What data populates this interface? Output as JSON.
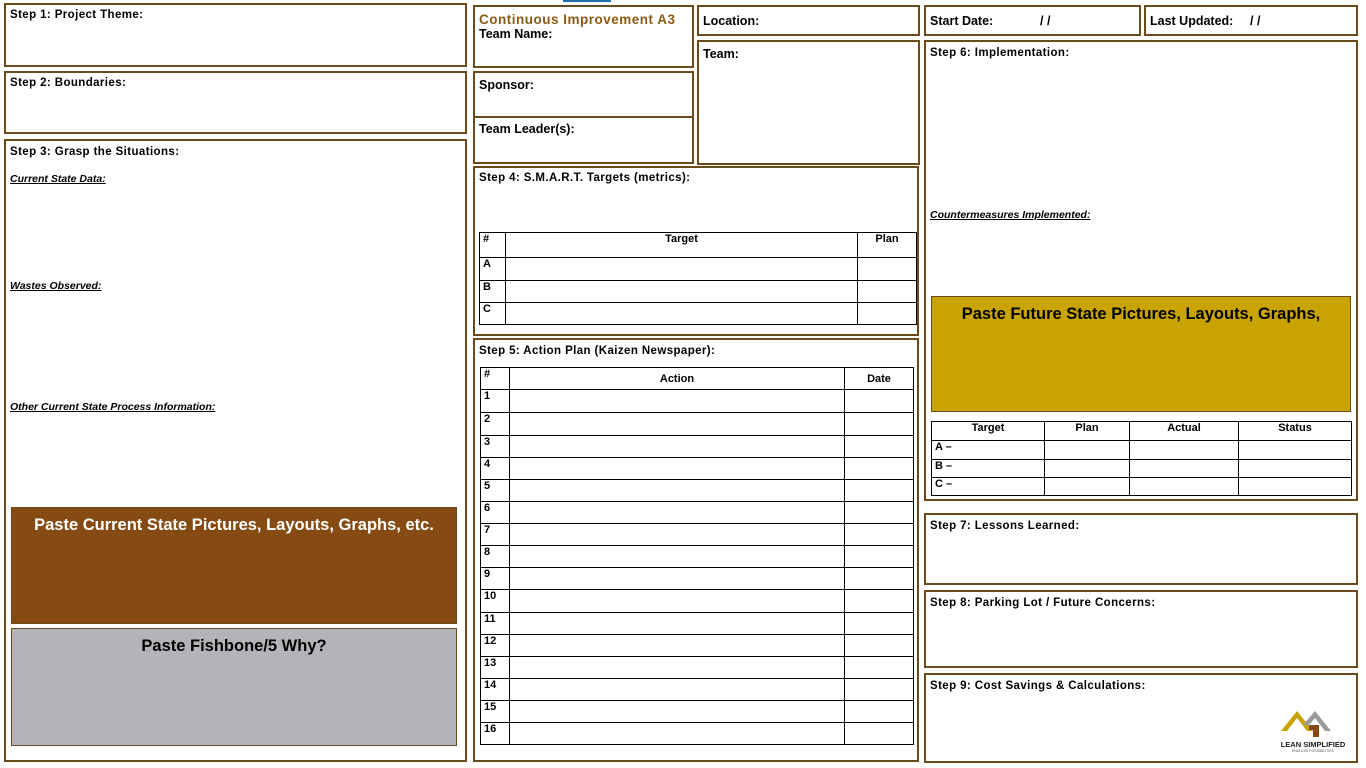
{
  "colors": {
    "border": "#6b4a1c",
    "brown_fill": "#854b12",
    "gold_fill": "#c9a400",
    "gray_fill": "#b3b4b8",
    "title": "#8a5a17"
  },
  "step1": {
    "label": "Step 1: Project Theme:"
  },
  "step2": {
    "label": "Step 2: Boundaries:"
  },
  "step3": {
    "label": "Step 3: Grasp the Situations:",
    "current_state": "Current State Data:",
    "wastes": "Wastes Observed:",
    "other": "Other Current State Process Information:",
    "paste_current": "Paste Current State Pictures, Layouts, Graphs, etc.",
    "paste_fishbone": "Paste Fishbone/5 Why?"
  },
  "header": {
    "title": "Continuous Improvement A3",
    "team_name": "Team Name:",
    "sponsor": "Sponsor:",
    "team_leaders": "Team Leader(s):",
    "location": "Location:",
    "team": "Team:",
    "start_date": "Start Date:",
    "start_date_value": "/   /",
    "last_updated": "Last Updated:",
    "last_updated_value": "/   /"
  },
  "step4": {
    "label": "Step 4: S.M.A.R.T. Targets  (metrics):",
    "columns": [
      "#",
      "Target",
      "Plan"
    ],
    "rows": [
      "A",
      "B",
      "C"
    ]
  },
  "step5": {
    "label": "Step 5: Action Plan (Kaizen Newspaper):",
    "columns": [
      "#",
      "Action",
      "Date"
    ],
    "rows": [
      "1",
      "2",
      "3",
      "4",
      "5",
      "6",
      "7",
      "8",
      "9",
      "10",
      "11",
      "12",
      "13",
      "14",
      "15",
      "16"
    ]
  },
  "step6": {
    "label": "Step 6: Implementation:",
    "countermeasures": "Countermeasures Implemented:",
    "paste_future": "Paste Future State Pictures, Layouts, Graphs,",
    "columns": [
      "Target",
      "Plan",
      "Actual",
      "Status"
    ],
    "rows": [
      "A –",
      "B –",
      "C –"
    ]
  },
  "step7": {
    "label": "Step 7: Lessons Learned:"
  },
  "step8": {
    "label": "Step 8: Parking Lot / Future Concerns:"
  },
  "step9": {
    "label": "Step 9: Cost Savings & Calculations:"
  },
  "logo": {
    "name": "LEAN SIMPLIFIED",
    "tagline": "ENDLESS POSSIBILITIES"
  }
}
